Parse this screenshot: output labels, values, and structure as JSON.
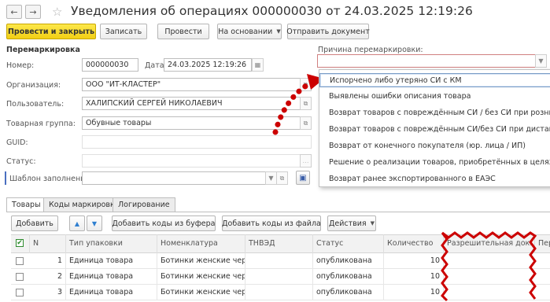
{
  "window": {
    "title": "Уведомления об операциях 000000030 от 24.03.2025 12:19:26",
    "back_glyph": "←",
    "forward_glyph": "→",
    "star_glyph": "☆"
  },
  "toolbar": {
    "post_close": "Провести и закрыть",
    "save": "Записать",
    "post": "Провести",
    "based_on": "На основании",
    "send": "Отправить документ"
  },
  "form": {
    "section_title": "Перемаркировка",
    "number_label": "Номер:",
    "number_value": "000000030",
    "date_label": "Дата:",
    "date_value": "24.03.2025 12:19:26",
    "org_label": "Организация:",
    "org_value": "ООО \"ИТ-КЛАСТЕР\"",
    "user_label": "Пользователь:",
    "user_value": "ХАЛИПСКИЙ СЕРГЕЙ НИКОЛАЕВИЧ",
    "group_label": "Товарная группа:",
    "group_value": "Обувные товары",
    "guid_label": "GUID:",
    "guid_value": "",
    "status_label": "Статус:",
    "status_value": "",
    "template_label": "Шаблон заполнения:",
    "template_value": "",
    "reason_label": "Причина перемаркировки:",
    "reason_value": ""
  },
  "reason_dropdown": {
    "items": [
      "Испорчено либо утеряно СИ с КМ",
      "Выявлены ошибки описания товара",
      "Возврат товаров с повреждённым СИ / без СИ при розничной реализации",
      "Возврат товаров с повреждённым СИ/без СИ при дистанционном способе продажи",
      "Возврат от конечного покупателя (юр. лица / ИП)",
      "Решение о реализации товаров, приобретённых в целях, не связанных с их реализацией",
      "Возврат ранее экспортированного в ЕАЭС"
    ],
    "selected_index": 0
  },
  "tabs": [
    "Товары",
    "Коды маркировки",
    "Логирование"
  ],
  "table_toolbar": {
    "add": "Добавить",
    "up_glyph": "▲",
    "down_glyph": "▼",
    "add_from_buffer": "Добавить коды из буфера",
    "add_from_file": "Добавить коды из файла",
    "actions": "Действия"
  },
  "table": {
    "columns": [
      "N",
      "Тип упаковки",
      "Номенклатура",
      "ТНВЭД",
      "Статус",
      "Количество",
      "Разрешительная док...",
      "Пер"
    ],
    "rows": [
      {
        "n": "1",
        "pack": "Единица товара",
        "nom": "Ботинки женские чер...",
        "tnved": "",
        "status": "опубликована",
        "qty": "10"
      },
      {
        "n": "2",
        "pack": "Единица товара",
        "nom": "Ботинки женские чер...",
        "tnved": "",
        "status": "опубликована",
        "qty": "10"
      },
      {
        "n": "3",
        "pack": "Единица товара",
        "nom": "Ботинки женские чер...",
        "tnved": "",
        "status": "опубликована",
        "qty": "10"
      }
    ]
  },
  "colors": {
    "accent_yellow": "#f5d41f",
    "annotation_red": "#cc0000",
    "selection_border": "#7a9cc6",
    "header_green": "#2e8b2e",
    "arrow_blue": "#2f7fd0"
  }
}
